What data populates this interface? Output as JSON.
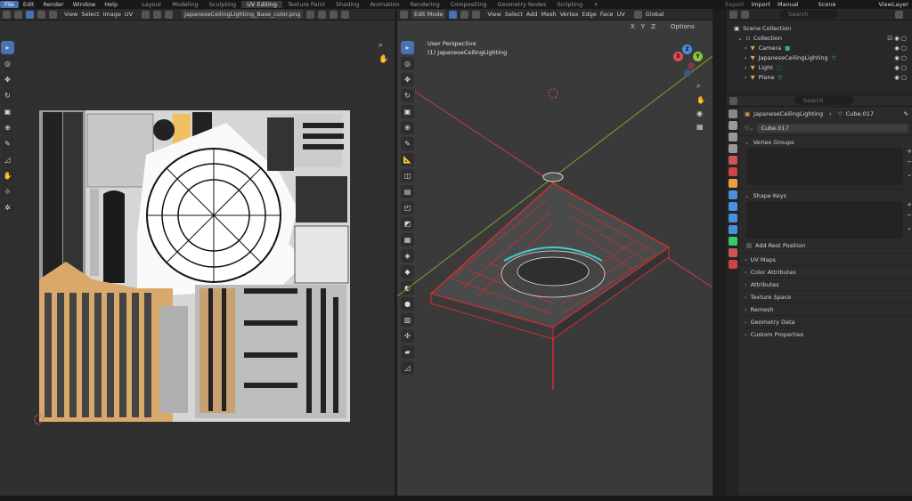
{
  "topbar": {
    "menus": [
      "File",
      "Edit",
      "Render",
      "Window",
      "Help"
    ],
    "workspaces": [
      "Layout",
      "Modeling",
      "Sculpting",
      "UV Editing",
      "Texture Paint",
      "Shading",
      "Animation",
      "Rendering",
      "Compositing",
      "Geometry Nodes",
      "Scripting"
    ],
    "active_workspace": "UV Editing",
    "add_tab": "+",
    "export": "Export",
    "import": "Import",
    "manual": "Manual",
    "scene": "Scene",
    "viewlayer": "ViewLayer"
  },
  "uv_editor": {
    "menus": [
      "View",
      "Select",
      "Image",
      "UV"
    ],
    "image_name": "JapaneseCeilingLighting_Base_color.png"
  },
  "viewport": {
    "mode": "Edit Mode",
    "menus": [
      "View",
      "Select",
      "Add",
      "Mesh",
      "Vertex",
      "Edge",
      "Face",
      "UV"
    ],
    "transform": "Global",
    "axes": [
      "X",
      "Y",
      "Z"
    ],
    "options": "Options",
    "perspective": "User Perspective",
    "object_label": "(1) JapaneseCeilingLighting",
    "gizmo": {
      "x": "X",
      "y": "Y",
      "z": "Z"
    }
  },
  "outliner": {
    "search_placeholder": "Search",
    "root": "Scene Collection",
    "collection": "Collection",
    "items": [
      "Camera",
      "JapaneseCeilingLighting",
      "Light",
      "Plane"
    ]
  },
  "properties": {
    "search_placeholder": "Search",
    "object": "JapaneseCeilingLighting",
    "mesh": "Cube.017",
    "data_field": "Cube.017",
    "sections": {
      "vertex_groups": "Vertex Groups",
      "shape_keys": "Shape Keys",
      "add_rest_position": "Add Rest Position",
      "uv_maps": "UV Maps",
      "color_attributes": "Color Attributes",
      "attributes": "Attributes",
      "texture_space": "Texture Space",
      "remesh": "Remesh",
      "geometry_data": "Geometry Data",
      "custom_properties": "Custom Properties"
    }
  },
  "colors": {
    "accent": "#4772b3",
    "mesh_red": "#d03030",
    "select_cyan": "#40d0d0",
    "x_axis": "#e04a5a",
    "y_axis": "#8cc63f",
    "z_axis": "#4a8fe0"
  }
}
